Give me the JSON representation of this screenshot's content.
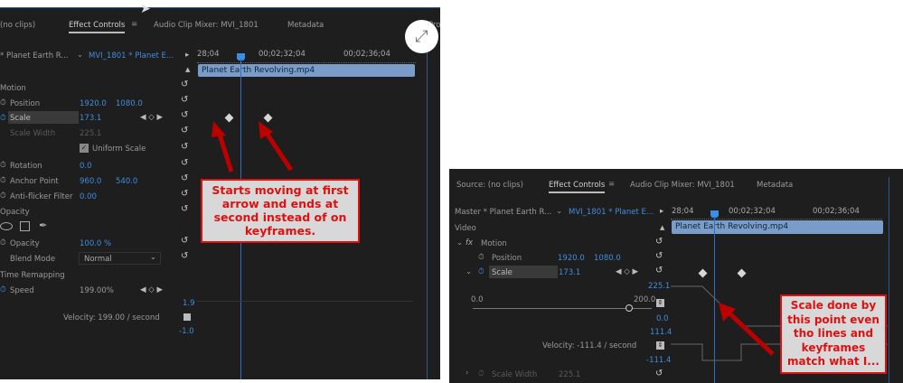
{
  "left": {
    "tabs": [
      "(no clips)",
      "Effect Controls",
      "Audio Clip Mixer: MVI_1801",
      "Metadata",
      "Pro"
    ],
    "menu_icon": "≡",
    "master_clip": "* Planet Earth R...",
    "sequence_clip": "MVI_1801 * Planet E...",
    "timecodes": [
      "28;04",
      "00;02;32;04",
      "00;02;36;04"
    ],
    "clip_name": "Planet Earth Revolving.mp4",
    "motion": "Motion",
    "position": {
      "label": "Position",
      "x": "1920.0",
      "y": "1080.0"
    },
    "scale": {
      "label": "Scale",
      "value": "173.1"
    },
    "scale_width": {
      "label": "Scale Width",
      "value": "225.1"
    },
    "uniform_scale": "Uniform Scale",
    "rotation": {
      "label": "Rotation",
      "value": "0.0"
    },
    "anchor": {
      "label": "Anchor Point",
      "x": "960.0",
      "y": "540.0"
    },
    "antiflicker": {
      "label": "Anti-flicker Filter",
      "value": "0.00"
    },
    "opacity_section": "Opacity",
    "opacity": {
      "label": "Opacity",
      "value": "100.0 %"
    },
    "blend": {
      "label": "Blend Mode",
      "value": "Normal"
    },
    "time_remap": "Time Remapping",
    "speed": {
      "label": "Speed",
      "value": "199.00%"
    },
    "graph_max": "1.9",
    "graph_min": "-1.0",
    "velocity": "Velocity: 199.00 / second",
    "annotation": "Starts moving at first arrow and ends at second instead of on keyframes."
  },
  "right": {
    "tabs": [
      "Source: (no clips)",
      "Effect Controls",
      "Audio Clip Mixer: MVI_1801",
      "Metadata"
    ],
    "master_clip": "Master * Planet Earth R...",
    "sequence_clip": "MVI_1801 * Planet E...",
    "timecodes": [
      "28;04",
      "00;02;32;04",
      "00;02;36;04"
    ],
    "clip_name": "Planet Earth Revolving.mp4",
    "video": "Video",
    "fx": "fx",
    "motion": "Motion",
    "position": {
      "label": "Position",
      "x": "1920.0",
      "y": "1080.0"
    },
    "scale": {
      "label": "Scale",
      "value": "173.1"
    },
    "graph_top": "225.1",
    "slider_min": "0.0",
    "slider_max": "200.0",
    "graph_zero": "0.0",
    "vel_max": "111.4",
    "velocity": "Velocity: -111.4 / second",
    "vel_min": "-111.4",
    "scale_width": {
      "label": "Scale Width",
      "value": "225.1"
    },
    "annotation": "Scale done by this point even tho lines and keyframes match what I..."
  }
}
